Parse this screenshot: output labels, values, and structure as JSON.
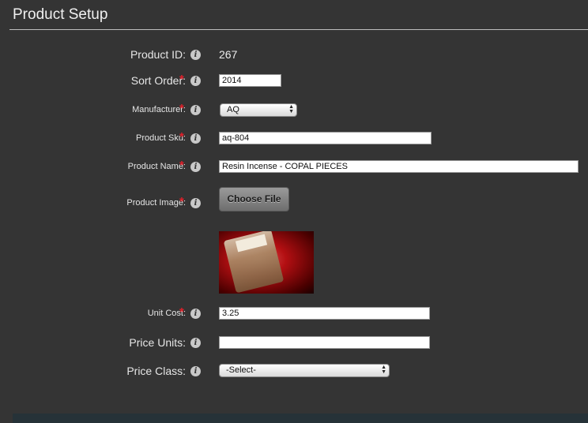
{
  "header": {
    "title": "Product Setup"
  },
  "form": {
    "product_id": {
      "label": "Product ID:",
      "value": "267"
    },
    "sort_order": {
      "label": "Sort Order:",
      "value": "2014"
    },
    "manufacturer": {
      "label": "Manufacturer:",
      "selected": "AQ"
    },
    "product_sku": {
      "label": "Product Sku:",
      "value": "aq-804"
    },
    "product_name": {
      "label": "Product Name:",
      "value": "Resin Incense - COPAL PIECES"
    },
    "product_image": {
      "label": "Product Image:",
      "button_label": "Choose File"
    },
    "unit_cost": {
      "label": "Unit Cost:",
      "value": "3.25"
    },
    "price_units": {
      "label": "Price Units:",
      "value": ""
    },
    "price_class": {
      "label": "Price Class:",
      "selected": "-Select-"
    }
  },
  "required_marker": "*",
  "info_icon_glyph": "i",
  "colors": {
    "background": "#343434",
    "required": "#e0202a",
    "footer": "#263238"
  }
}
